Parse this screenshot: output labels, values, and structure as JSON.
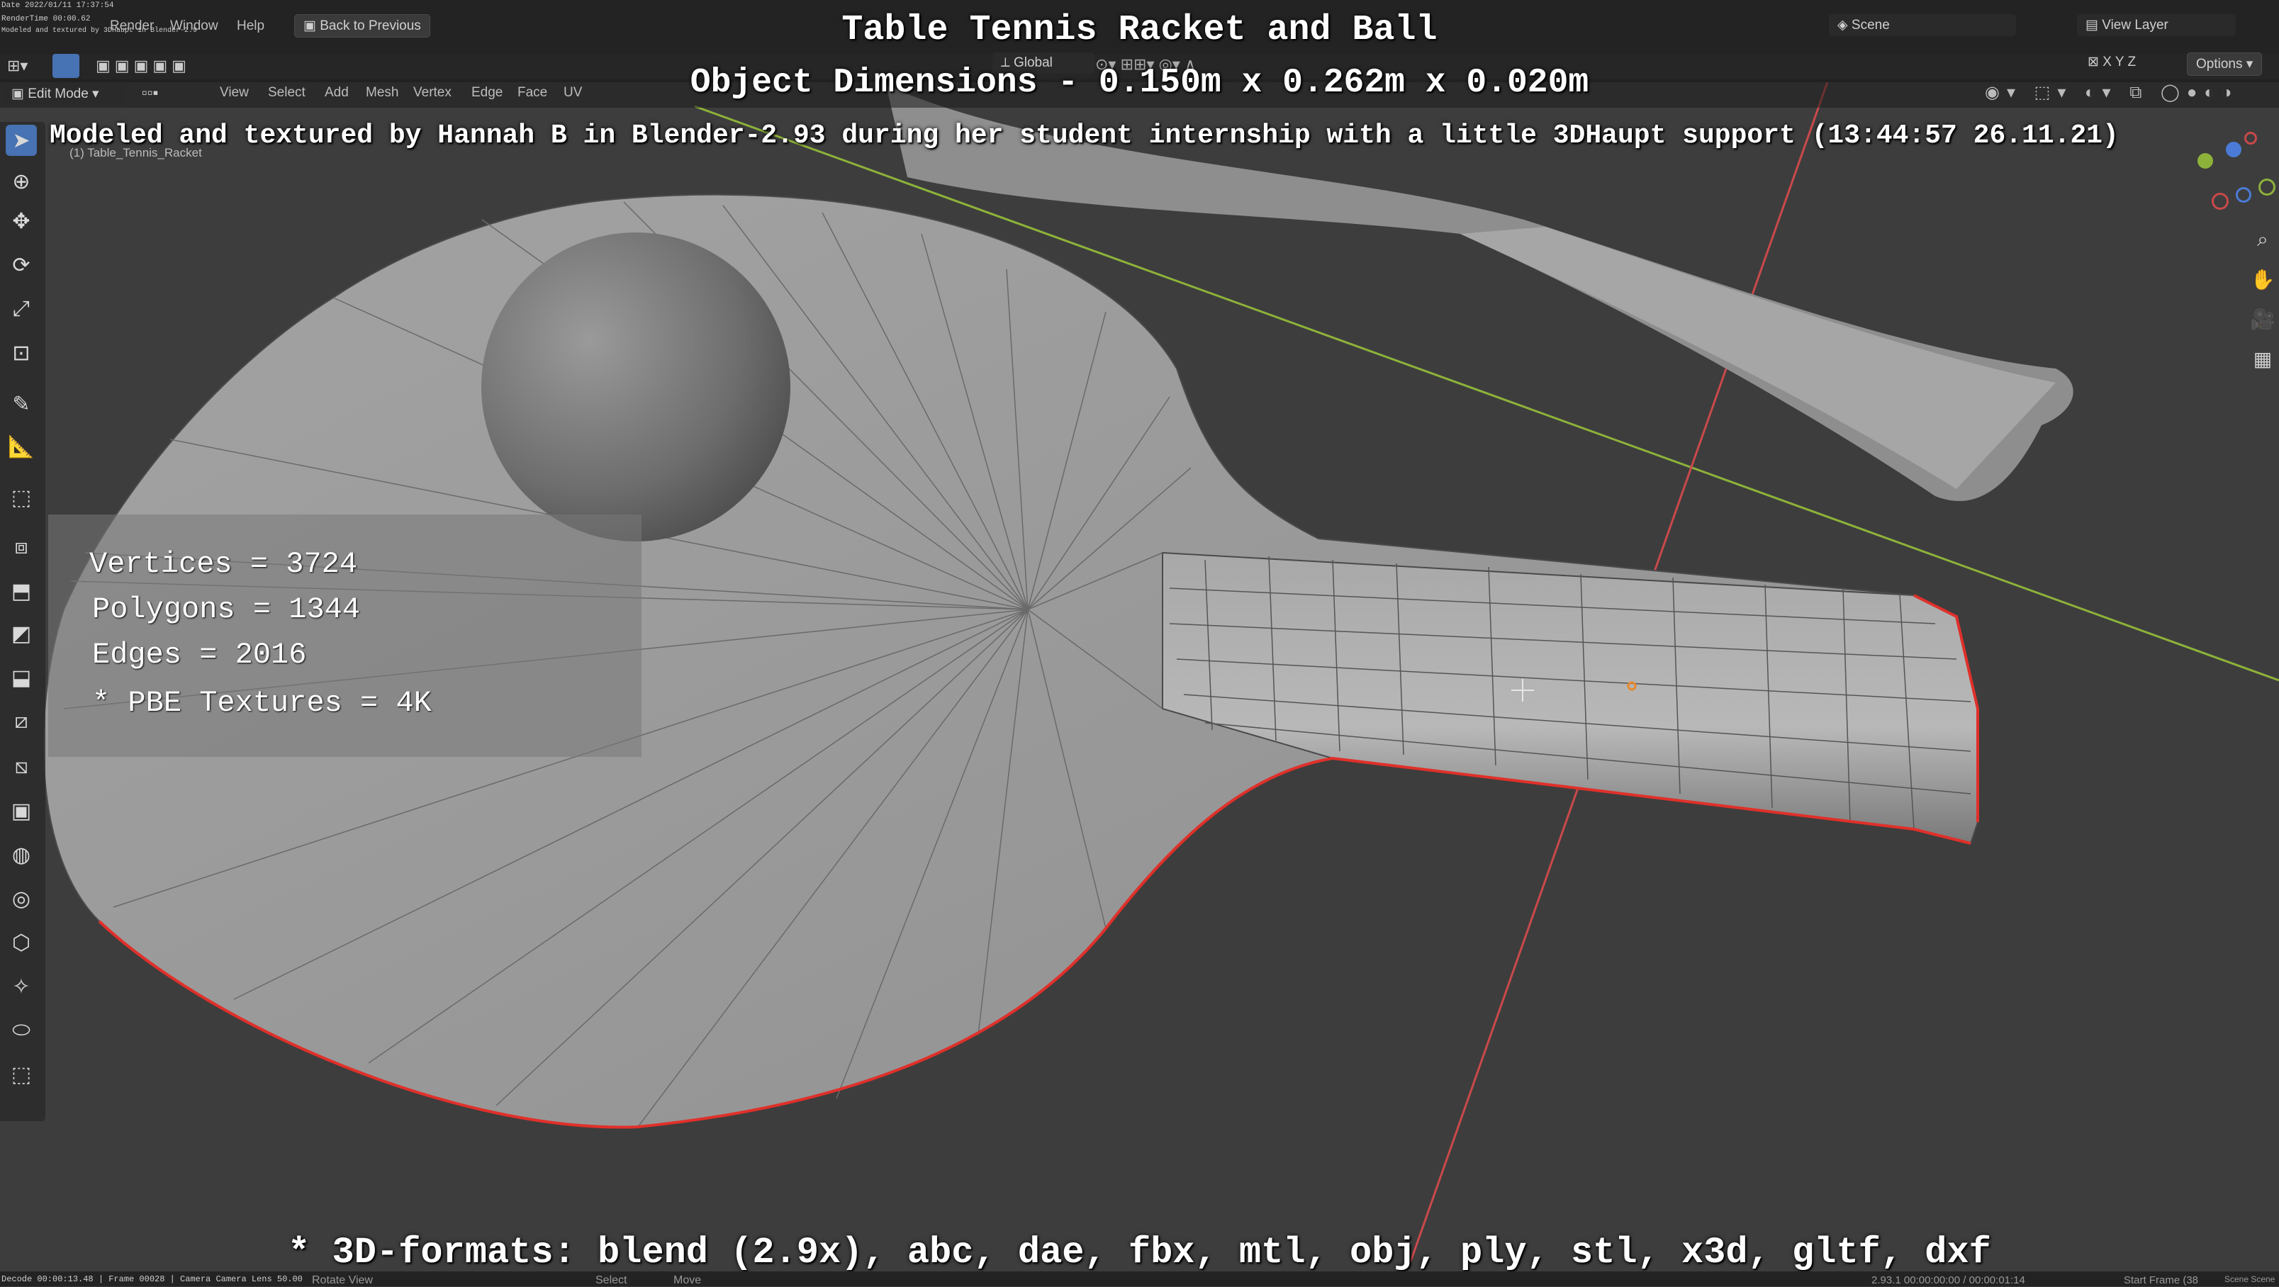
{
  "overlay": {
    "title": "Table Tennis Racket and Ball",
    "dimensions": "Object Dimensions -  0.150m x 0.262m x 0.020m",
    "credit": "Modeled and textured by Hannah B in Blender-2.93 during her student internship with a little 3DHaupt support (13:44:57 26.11.21)",
    "formats": "* 3D-formats: blend (2.9x), abc, dae, fbx, mtl, obj, ply, stl, x3d, gltf, dxf"
  },
  "stats": {
    "vertices": "Vertices = 3724",
    "polygons": "Polygons = 1344",
    "edges": "Edges = 2016",
    "textures": "* PBE Textures = 4K"
  },
  "topbar": {
    "date_line": "Date 2022/01/11 17:37:54",
    "render_line": "RenderTime 00:00.62",
    "model_line": "Modeled and textured by 3DHaupt in Blender-2.9",
    "menus": [
      "Render",
      "Window",
      "Help"
    ],
    "back_button": "Back to Previous",
    "scene_label": "Scene",
    "view_layer_label": "View Layer"
  },
  "header": {
    "mode": "Edit Mode",
    "menus": [
      "View",
      "Select",
      "Add",
      "Mesh",
      "Vertex",
      "Edge",
      "Face",
      "UV"
    ],
    "transform_orientation": "Global",
    "options": "Options",
    "object_name": "(1) Table_Tennis_Racket",
    "axes": [
      "X",
      "Y",
      "Z"
    ]
  },
  "statusbar": {
    "left_info": "Decode 00:00:13.48 | Frame 00028 | Camera Camera   Lens 50.00",
    "rotate_label": "Rotate View",
    "select_label": "Select",
    "move_label": "Move",
    "version_time": "2.93.1   00:00:00:00 / 00:00:01:14",
    "start_frame": "Start Frame (38",
    "scene_scene": "Scene Scene"
  },
  "colors": {
    "accent": "#4772b3",
    "grid_red": "#c9494b",
    "grid_green": "#8db23a",
    "selected_edge": "#e0302a",
    "origin": "#e8892a"
  },
  "icons": {
    "tools": [
      "select-box-icon",
      "cursor-icon",
      "move-icon",
      "rotate-icon",
      "scale-icon",
      "transform-icon",
      "annotate-icon",
      "measure-icon",
      "add-cube-icon",
      "extrude-icon",
      "inset-icon",
      "bevel-icon",
      "loop-cut-icon",
      "knife-icon",
      "poly-build-icon",
      "spin-icon",
      "smooth-icon",
      "edge-slide-icon",
      "shrink-fatten-icon",
      "shear-icon",
      "rip-icon"
    ],
    "navigation": [
      "zoom-icon",
      "pan-hand-icon",
      "camera-view-icon",
      "perspective-grid-icon"
    ]
  }
}
